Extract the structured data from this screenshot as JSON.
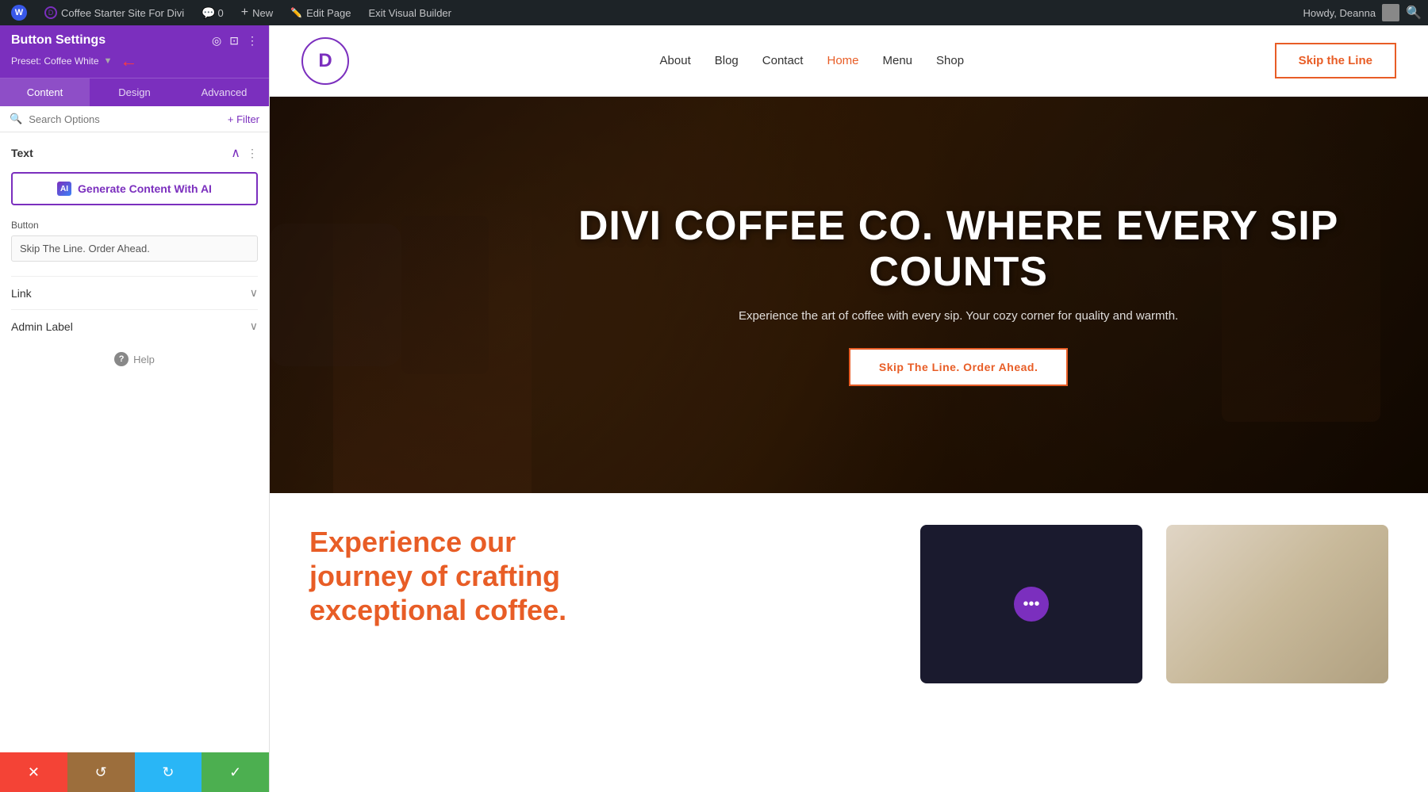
{
  "admin_bar": {
    "wp_icon": "W",
    "site_name": "Coffee Starter Site For Divi",
    "comments_count": "0",
    "new_label": "New",
    "edit_page": "Edit Page",
    "exit_builder": "Exit Visual Builder",
    "howdy": "Howdy, Deanna"
  },
  "left_panel": {
    "title": "Button Settings",
    "preset_label": "Preset: Coffee White",
    "tabs": [
      "Content",
      "Design",
      "Advanced"
    ],
    "active_tab": "Content",
    "search_placeholder": "Search Options",
    "filter_label": "+ Filter",
    "text_section": {
      "label": "Text",
      "ai_button_label": "Generate Content With AI",
      "ai_icon_text": "AI"
    },
    "button_section": {
      "label": "Button",
      "value": "Skip The Line. Order Ahead."
    },
    "link_section": {
      "label": "Link"
    },
    "admin_label_section": {
      "label": "Admin Label"
    },
    "help_label": "Help"
  },
  "bottom_bar": {
    "close_icon": "✕",
    "undo_icon": "↺",
    "redo_icon": "↻",
    "save_icon": "✓"
  },
  "site_header": {
    "logo_letter": "D",
    "nav_items": [
      "About",
      "Blog",
      "Contact",
      "Home",
      "Menu",
      "Shop"
    ],
    "active_nav": "Home",
    "cta_button": "Skip the Line"
  },
  "hero": {
    "title": "DIVI COFFEE CO. WHERE EVERY SIP COUNTS",
    "subtitle": "Experience the art of coffee with every sip. Your cozy corner for quality and warmth.",
    "cta_button": "Skip The Line. Order Ahead."
  },
  "below_hero": {
    "heading_line1": "Experience our",
    "heading_line2": "journey of crafting",
    "heading_line3": "exceptional coffee.",
    "card_btn_icon": "•••"
  },
  "colors": {
    "purple": "#7b2fbe",
    "orange": "#e85d26",
    "dark_bg": "#1d2327",
    "panel_bg": "#7b2fbe"
  }
}
